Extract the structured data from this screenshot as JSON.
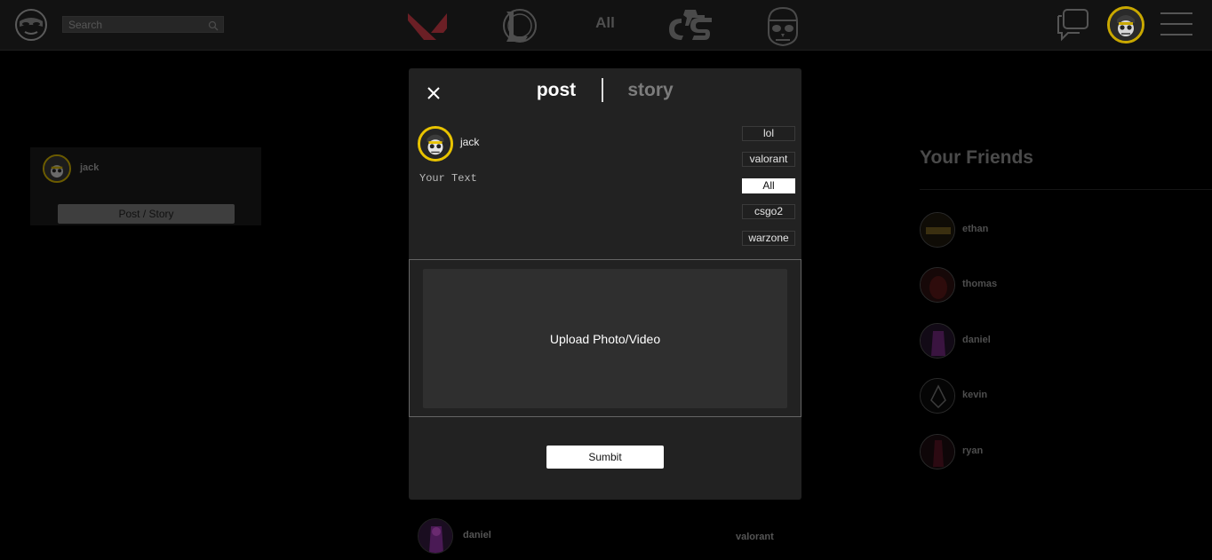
{
  "navbar": {
    "search_placeholder": "Search",
    "games": [
      {
        "name": "valorant-logo-icon"
      },
      {
        "name": "league-of-legends-logo-icon"
      },
      {
        "name": "counter-strike-logo-icon"
      },
      {
        "name": "warzone-skull-logo-icon"
      }
    ],
    "all_label": "All",
    "accent_color": "#c9a800"
  },
  "left_panel": {
    "username": "jack",
    "post_story_label": "Post / Story"
  },
  "friends": {
    "title": "Your Friends",
    "list": [
      {
        "name": "ethan"
      },
      {
        "name": "thomas"
      },
      {
        "name": "daniel"
      },
      {
        "name": "kevin"
      },
      {
        "name": "ryan"
      }
    ]
  },
  "feed": {
    "username": "daniel",
    "game": "valorant"
  },
  "modal": {
    "tab_post": "post",
    "tab_story": "story",
    "active_tab": "post",
    "username": "jack",
    "text_placeholder": "Your Text",
    "categories": [
      {
        "label": "lol",
        "active": false
      },
      {
        "label": "valorant",
        "active": false
      },
      {
        "label": "All",
        "active": true
      },
      {
        "label": "csgo2",
        "active": false
      },
      {
        "label": "warzone",
        "active": false
      }
    ],
    "upload_label": "Upload Photo/Video",
    "submit_label": "Sumbit"
  }
}
